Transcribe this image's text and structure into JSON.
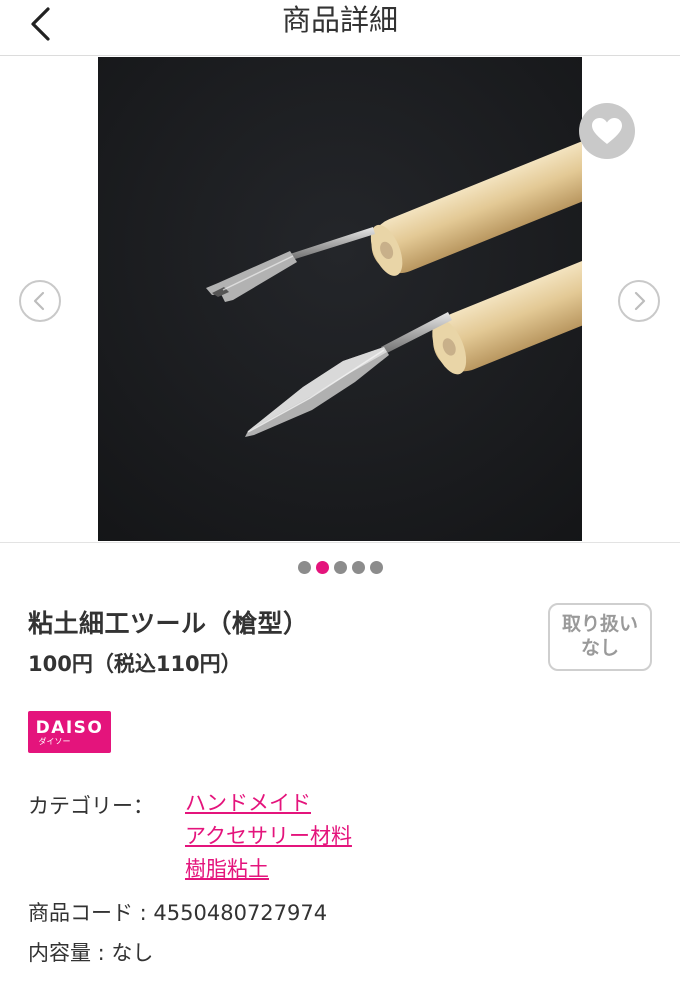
{
  "header": {
    "title": "商品詳細",
    "back_icon": "chevron-left-icon"
  },
  "gallery": {
    "prev_icon": "chevron-left-circle-icon",
    "next_icon": "chevron-right-circle-icon",
    "favorite_icon": "heart-icon",
    "image_description": "clay sculpting tool photo",
    "dot_count": 5,
    "active_dot_index": 1
  },
  "product": {
    "name": "粘土細工ツール（槍型）",
    "price": "100円（税込110円）",
    "handling_badge": "取り扱い\nなし"
  },
  "brand": {
    "logo_main": "DAISO",
    "logo_sub": "ダイソー"
  },
  "details": {
    "category_label": "カテゴリー：",
    "categories": [
      "ハンドメイド",
      "アクセサリー材料",
      "樹脂粘土"
    ],
    "code_label": "商品コード : 4550480727974",
    "contents_label": "内容量 : なし"
  },
  "colors": {
    "accent": "#e4147c",
    "text": "#333333",
    "muted": "#9a9a9a",
    "photo_bg": "#191a1c"
  }
}
